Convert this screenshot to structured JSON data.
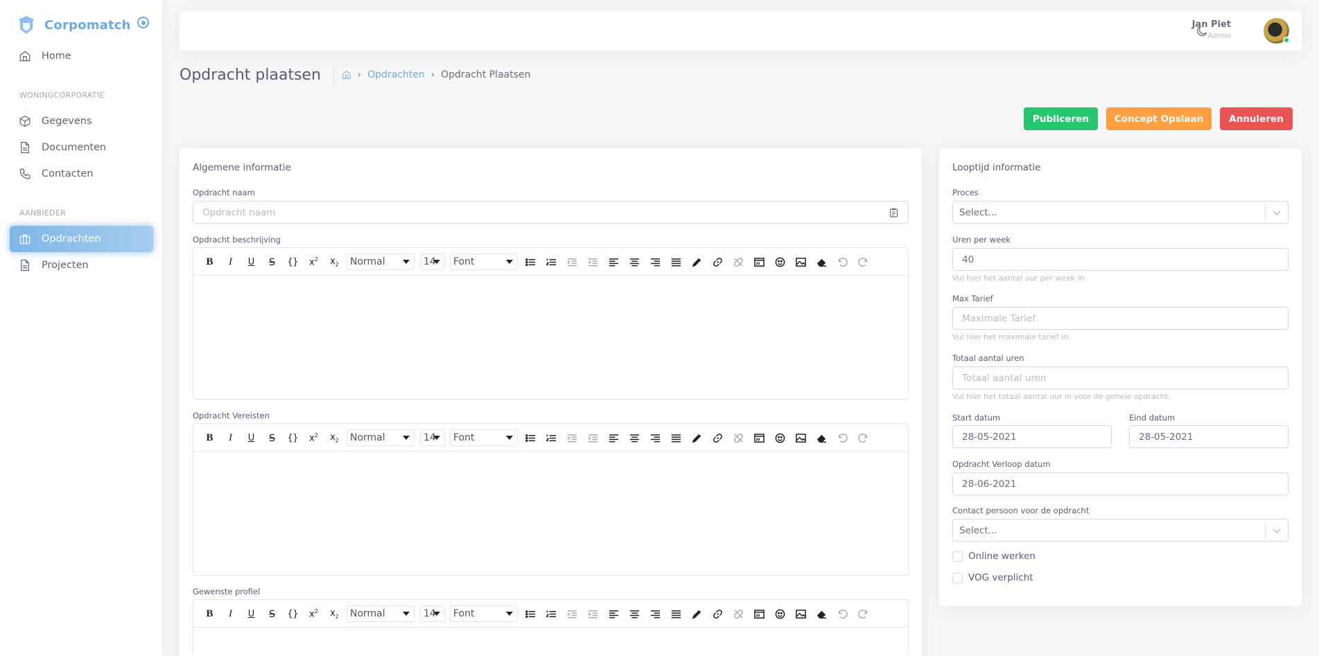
{
  "brand": {
    "name": "Corpomatch"
  },
  "sidebar": {
    "home": "Home",
    "section1": "WONINGCORPORATIE",
    "items1": [
      "Gegevens",
      "Documenten",
      "Contacten"
    ],
    "section2": "AANBIEDER",
    "items2": [
      "Opdrachten",
      "Projecten"
    ]
  },
  "user": {
    "name": "Jan Piet",
    "role": "Admin",
    "status_color": "#28c76f"
  },
  "page": {
    "title": "Opdracht plaatsen",
    "breadcrumb_link": "Opdrachten",
    "breadcrumb_current": "Opdracht Plaatsen"
  },
  "actions": {
    "publish": "Publiceren",
    "save_draft": "Concept Opslaan",
    "cancel": "Annuleren"
  },
  "general": {
    "title": "Algemene informatie",
    "name_label": "Opdracht naam",
    "name_placeholder": "Opdracht naam",
    "description_label": "Opdracht beschrijving",
    "requirements_label": "Opdracht Vereisten",
    "profile_label": "Gewenste profiel"
  },
  "editor": {
    "style": "Normal",
    "size": "14",
    "font": "Font"
  },
  "runtime": {
    "title": "Looptijd informatie",
    "process_label": "Proces",
    "process_value": "Select...",
    "hours_label": "Uren per week",
    "hours_value": "40",
    "hours_hint": "Vul hier het aantal uur per week in.",
    "rate_label": "Max Tarief",
    "rate_placeholder": "Maximale Tarief",
    "rate_hint": "Vul hier het maximale tarief in.",
    "total_label": "Totaal aantal uren",
    "total_placeholder": "Totaal aantal uren",
    "total_hint": "Vul hier het totaal aantal uur in voor de gehele opdracht.",
    "start_label": "Start datum",
    "start_value": "28-05-2021",
    "end_label": "Eind datum",
    "end_value": "28-05-2021",
    "expiry_label": "Opdracht Verloop datum",
    "expiry_value": "28-06-2021",
    "contact_label": "Contact persoon voor de opdracht",
    "contact_value": "Select...",
    "online_label": "Online werken",
    "vog_label": "VOG verplicht"
  },
  "colors": {
    "primary": "#6fa9dd",
    "success": "#28c76f",
    "warning": "#ff9f43",
    "danger": "#ea5455"
  }
}
